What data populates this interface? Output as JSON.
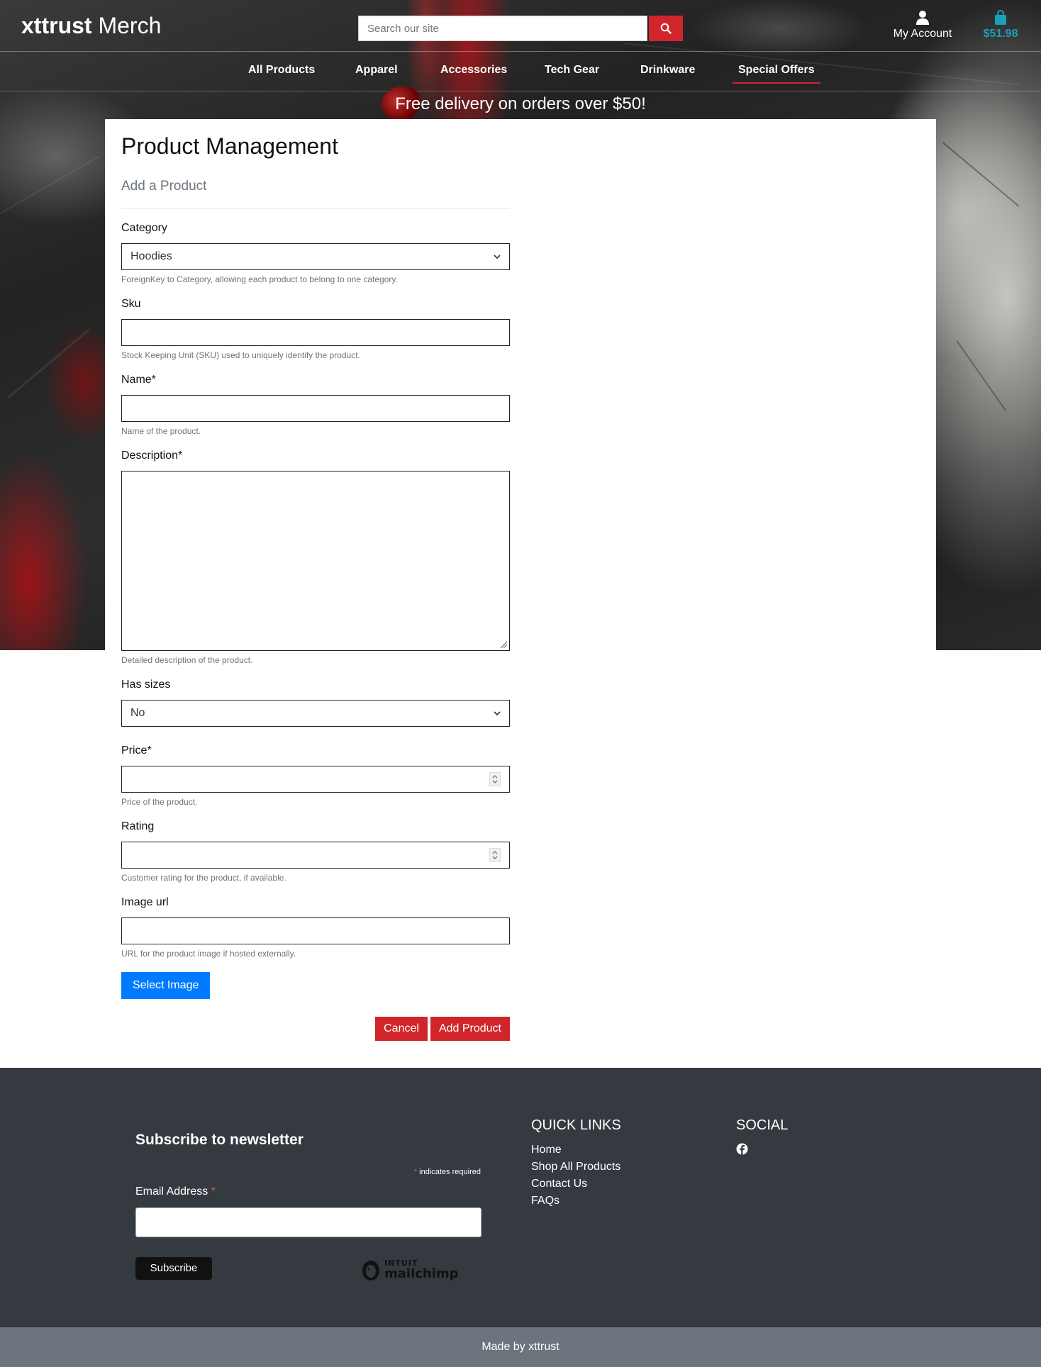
{
  "header": {
    "brand_bold": "xttrust",
    "brand_rest": " Merch",
    "search_placeholder": "Search our site",
    "account_label": "My Account",
    "cart_total": "$51.98"
  },
  "nav": {
    "items": [
      {
        "label": "All Products"
      },
      {
        "label": "Apparel"
      },
      {
        "label": "Accessories"
      },
      {
        "label": "Tech Gear"
      },
      {
        "label": "Drinkware"
      },
      {
        "label": "Special Offers",
        "active": true
      }
    ]
  },
  "promo": "Free delivery on orders over $50!",
  "page": {
    "title": "Product Management",
    "subtitle": "Add a Product"
  },
  "form": {
    "category": {
      "label": "Category",
      "value": "Hoodies",
      "help": "ForeignKey to Category, allowing each product to belong to one category."
    },
    "sku": {
      "label": "Sku",
      "help": "Stock Keeping Unit (SKU) used to uniquely identify the product."
    },
    "name": {
      "label": "Name*",
      "help": "Name of the product."
    },
    "description": {
      "label": "Description*",
      "help": "Detailed description of the product."
    },
    "has_sizes": {
      "label": "Has sizes",
      "value": "No"
    },
    "price": {
      "label": "Price*",
      "help": "Price of the product."
    },
    "rating": {
      "label": "Rating",
      "help": "Customer rating for the product, if available."
    },
    "image_url": {
      "label": "Image url",
      "help": "URL for the product image if hosted externally."
    },
    "select_image": "Select Image",
    "cancel": "Cancel",
    "submit": "Add Product"
  },
  "footer": {
    "newsletter_title": "Subscribe to newsletter",
    "required_star": "*",
    "required_note": " indicates required",
    "email_label": "Email Address ",
    "email_star": "*",
    "subscribe": "Subscribe",
    "mailchimp_small": "INTUIT",
    "mailchimp_big": "mailchimp",
    "quick_links_title": "QUICK LINKS",
    "quick_links": [
      "Home",
      "Shop All Products",
      "Contact Us",
      "FAQs"
    ],
    "social_title": "SOCIAL",
    "made_by": "Made by xttrust"
  },
  "colors": {
    "accent_red": "#d0262b",
    "primary_blue": "#007bff",
    "cart_teal": "#17a2b8",
    "footer_dark": "#343a40",
    "footer_bar": "#6c757d"
  }
}
